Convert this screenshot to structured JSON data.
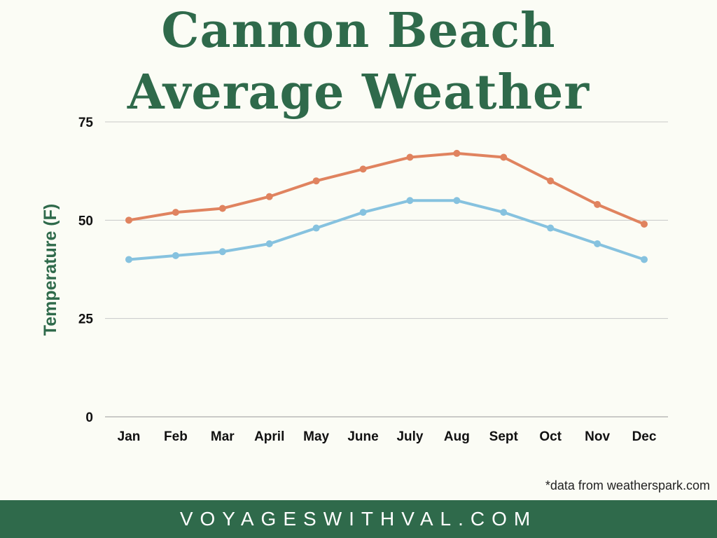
{
  "title_line1": "Cannon Beach",
  "title_line2": "Average Weather",
  "note": "*data from weatherspark.com",
  "footer": "VOYAGESWITHVAL.COM",
  "chart_data": {
    "type": "line",
    "title": "Cannon Beach Average Weather",
    "xlabel": "",
    "ylabel": "Temperature (F)",
    "categories": [
      "Jan",
      "Feb",
      "Mar",
      "April",
      "May",
      "June",
      "July",
      "Aug",
      "Sept",
      "Oct",
      "Nov",
      "Dec"
    ],
    "ylim": [
      0,
      75
    ],
    "yticks": [
      0,
      25,
      50,
      75
    ],
    "grid": true,
    "legend": "none",
    "series": [
      {
        "color": "#e0835f",
        "values": [
          50,
          52,
          53,
          56,
          60,
          63,
          66,
          67,
          66,
          60,
          54,
          49
        ]
      },
      {
        "color": "#86c2df",
        "values": [
          40,
          41,
          42,
          44,
          48,
          52,
          55,
          55,
          52,
          48,
          44,
          40
        ]
      }
    ]
  }
}
